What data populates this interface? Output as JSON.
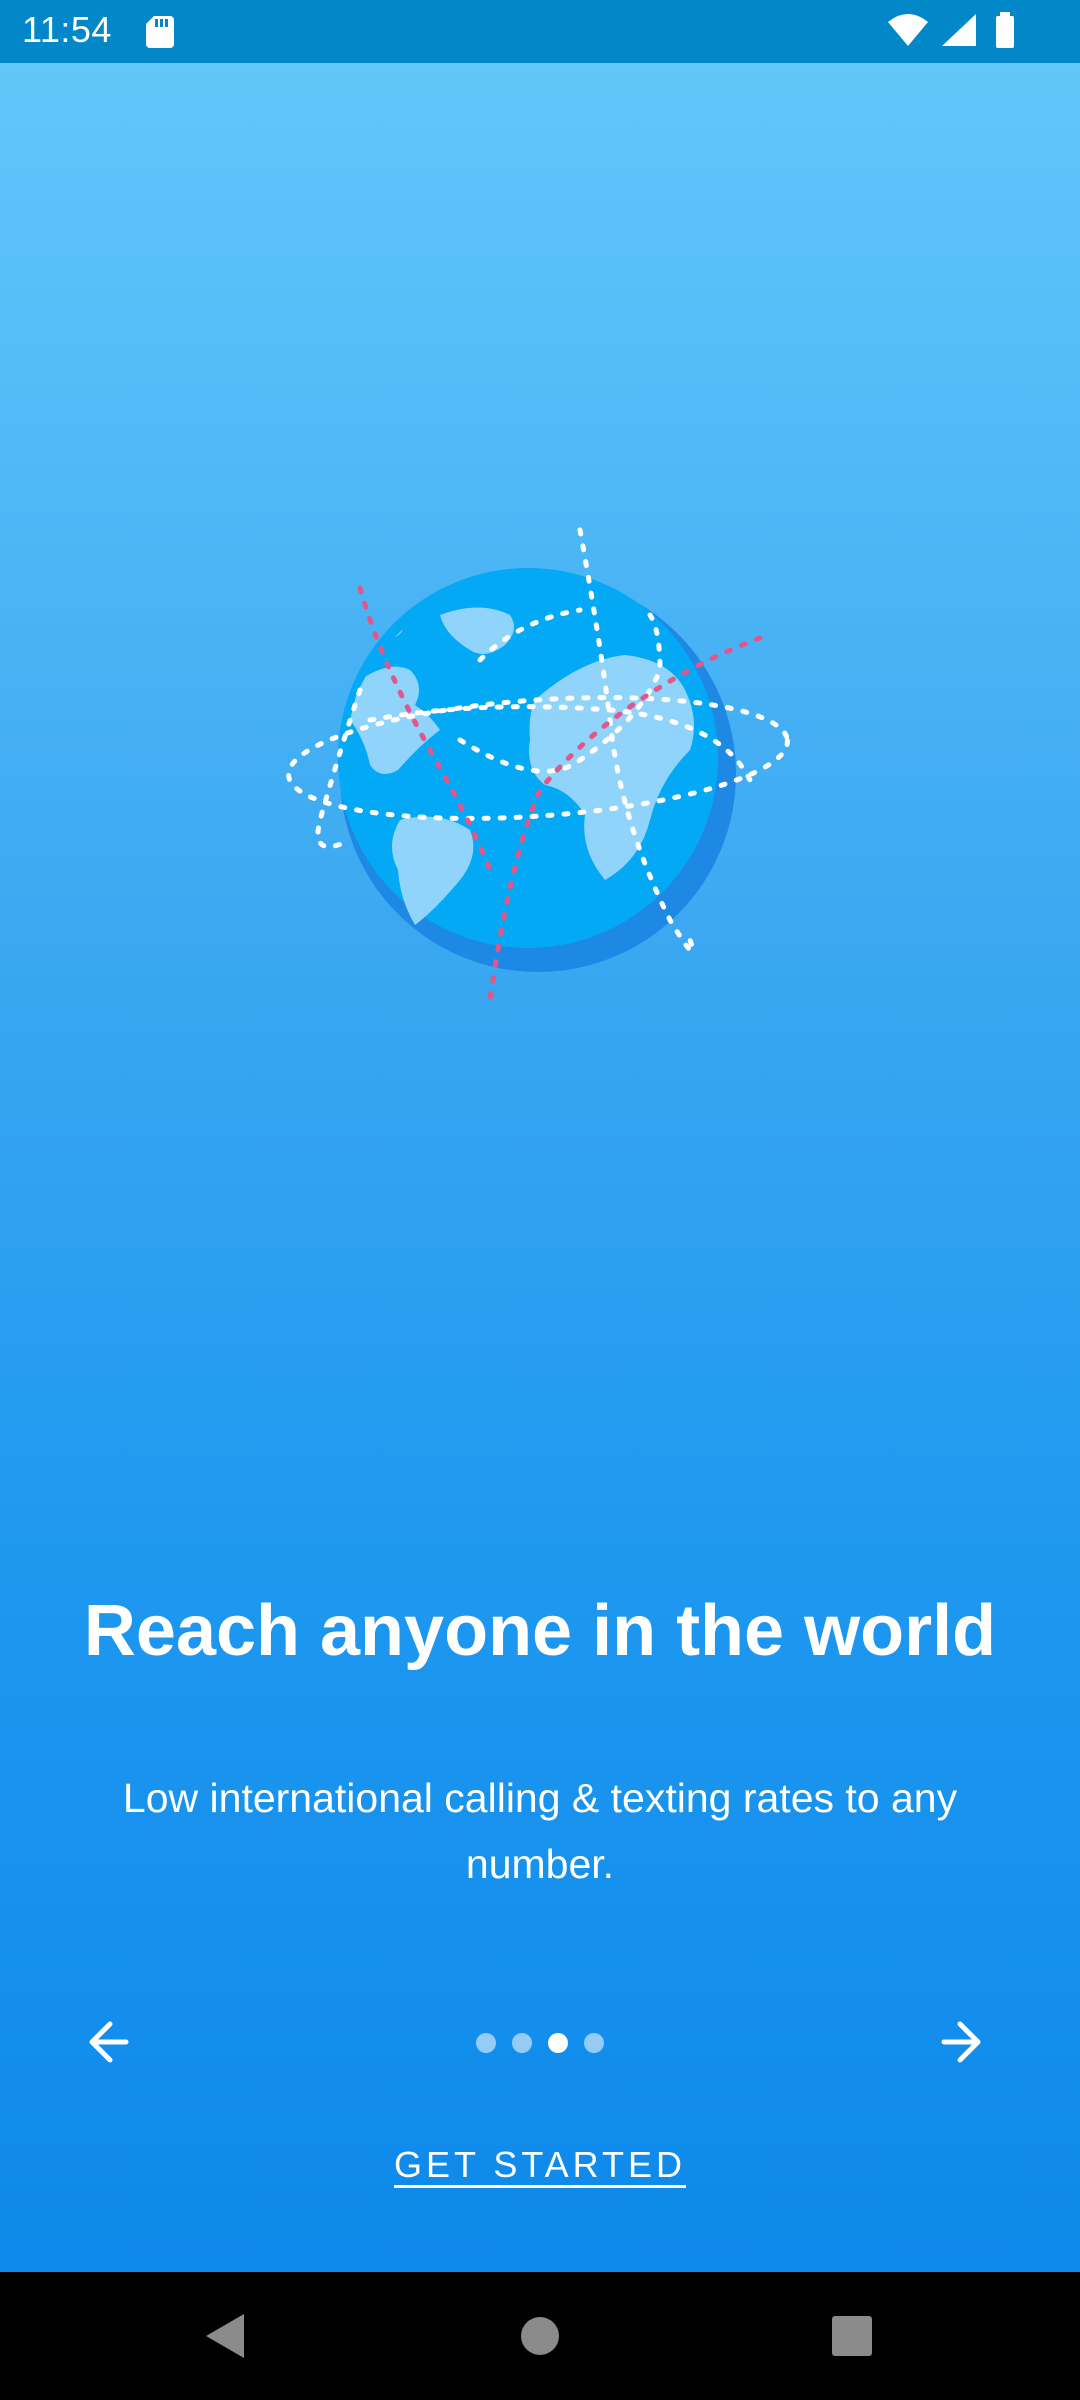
{
  "status_bar": {
    "time": "11:54",
    "icons": [
      "sd-card-icon",
      "wifi-icon",
      "signal-icon",
      "battery-icon"
    ]
  },
  "onboarding": {
    "illustration": "globe-icon",
    "title": "Reach anyone in the world",
    "description": "Low international calling & texting rates to any number.",
    "page_indicator": {
      "total": 4,
      "current": 3
    },
    "prev_icon": "arrow-left-icon",
    "next_icon": "arrow-right-icon",
    "cta_label": "GET STARTED"
  },
  "system_nav": {
    "icons": [
      "back-icon",
      "home-icon",
      "recents-icon"
    ]
  },
  "colors": {
    "gradient_top": "#64c9fb",
    "gradient_bottom": "#0a86ea",
    "status_bar": "#0288c9",
    "globe_ocean": "#03a9f4",
    "globe_shadow": "#1e88e5",
    "land": "#90d4fb",
    "dashes_white": "#ffffff",
    "dashes_pink": "#e2578a"
  }
}
